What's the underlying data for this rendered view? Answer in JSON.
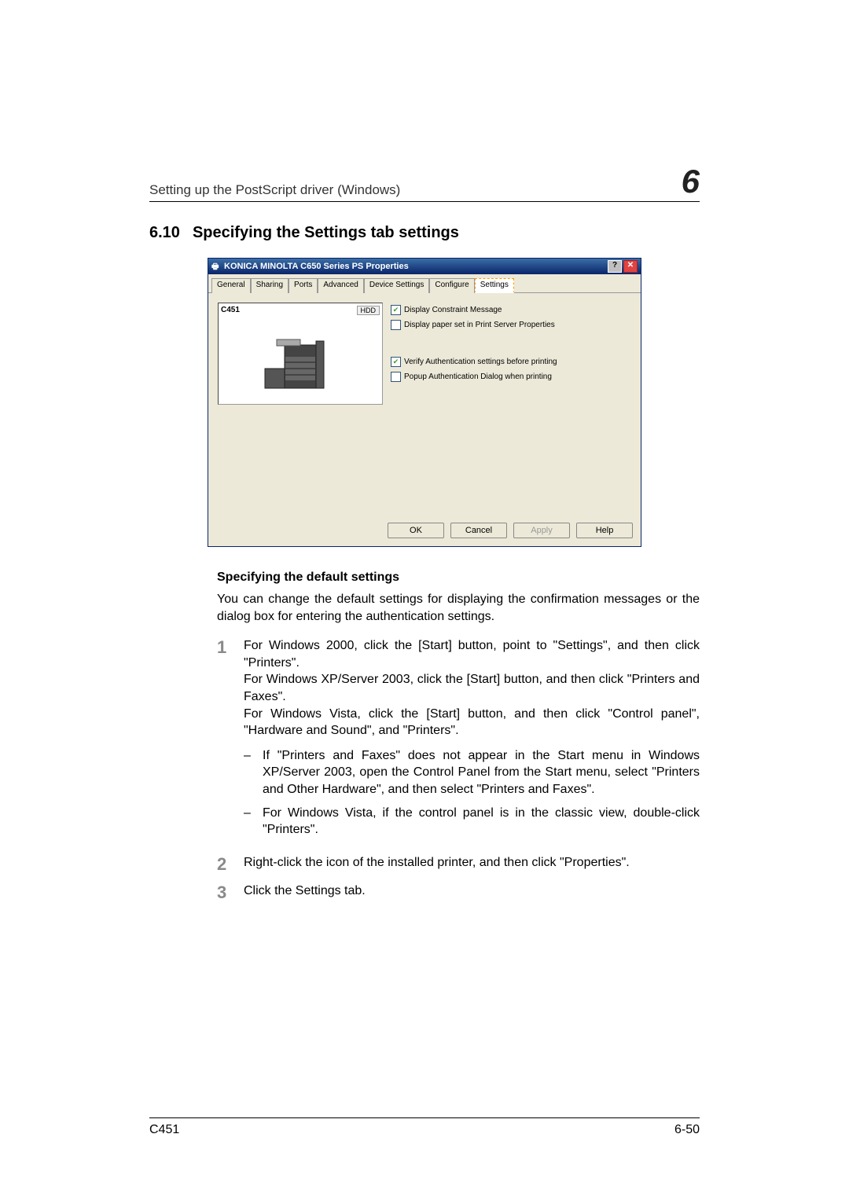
{
  "runningHead": {
    "title": "Setting up the PostScript driver (Windows)",
    "chapter": "6"
  },
  "heading": {
    "number": "6.10",
    "title": "Specifying the Settings tab settings"
  },
  "dialog": {
    "title": "KONICA MINOLTA C650 Series PS Properties",
    "helpGlyph": "?",
    "closeGlyph": "✕",
    "tabs": [
      "General",
      "Sharing",
      "Ports",
      "Advanced",
      "Device Settings",
      "Configure",
      "Settings"
    ],
    "activeTab": "Settings",
    "deviceName": "C451",
    "hddBadge": "HDD",
    "checkboxes": {
      "displayConstraint": {
        "checked": true,
        "label": "Display Constraint Message"
      },
      "displayPaperSet": {
        "checked": false,
        "label": "Display paper set in Print Server Properties"
      },
      "verifyAuth": {
        "checked": true,
        "label": "Verify Authentication settings before printing"
      },
      "popupAuth": {
        "checked": false,
        "label": "Popup Authentication Dialog when printing"
      }
    },
    "buttons": {
      "ok": "OK",
      "cancel": "Cancel",
      "apply": "Apply",
      "help": "Help"
    }
  },
  "subhead": "Specifying the default settings",
  "intro": "You can change the default settings for displaying the confirmation messages or the dialog box for entering the authentication settings.",
  "steps": [
    {
      "num": "1",
      "lines": [
        "For Windows 2000, click the [Start] button, point to \"Settings\", and then click \"Printers\".",
        "For Windows XP/Server 2003, click the [Start] button, and then click \"Printers and Faxes\".",
        "For Windows Vista, click the [Start] button, and then click \"Control panel\", \"Hardware and Sound\", and \"Printers\"."
      ],
      "sub": [
        "If \"Printers and Faxes\" does not appear in the Start menu in Windows XP/Server 2003, open the Control Panel from the Start menu, select \"Printers and Other Hardware\", and then select \"Printers and Faxes\".",
        "For Windows Vista, if the control panel is in the classic view, double-click \"Printers\"."
      ]
    },
    {
      "num": "2",
      "lines": [
        "Right-click the icon of the installed printer, and then click \"Properties\"."
      ],
      "sub": []
    },
    {
      "num": "3",
      "lines": [
        "Click the Settings tab."
      ],
      "sub": []
    }
  ],
  "footer": {
    "left": "C451",
    "right": "6-50"
  }
}
